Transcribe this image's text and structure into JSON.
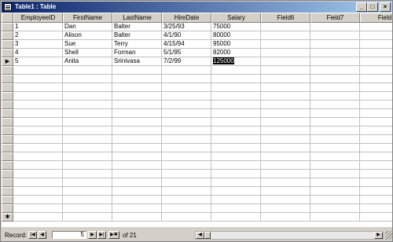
{
  "window": {
    "title": "Table1 : Table",
    "minimize_label": "_",
    "maximize_label": "□",
    "close_label": "×"
  },
  "table": {
    "columns": [
      "EmployeeID",
      "FirstName",
      "LastName",
      "HireDate",
      "Salary",
      "Field6",
      "Field7",
      "Field"
    ],
    "rows": [
      [
        "1",
        "Dan",
        "Balter",
        "3/25/93",
        "75000",
        "",
        "",
        ""
      ],
      [
        "2",
        "Alison",
        "Balter",
        "4/1/90",
        "80000",
        "",
        "",
        ""
      ],
      [
        "3",
        "Sue",
        "Terry",
        "4/15/94",
        "95000",
        "",
        "",
        ""
      ],
      [
        "4",
        "Shell",
        "Forman",
        "5/1/95",
        "82000",
        "",
        "",
        ""
      ],
      [
        "5",
        "Anita",
        "Srinivasa",
        "7/2/99",
        "125000",
        "",
        "",
        ""
      ]
    ],
    "current_row_marker": "▶",
    "new_row_marker": "✱",
    "selected_cell": {
      "row": 5,
      "column": "Salary"
    }
  },
  "status": {
    "record_label": "Record:",
    "current_record": "5",
    "of_label": "of",
    "total_records": "21",
    "first_icon": "|◀",
    "prev_icon": "◀",
    "next_icon": "▶",
    "last_icon": "▶|",
    "new_icon": "▶✱"
  },
  "colors": {
    "titlebar_start": "#0a246a",
    "titlebar_end": "#a6caf0",
    "chrome": "#d4d0c8",
    "gridline": "#c0c0c0"
  }
}
